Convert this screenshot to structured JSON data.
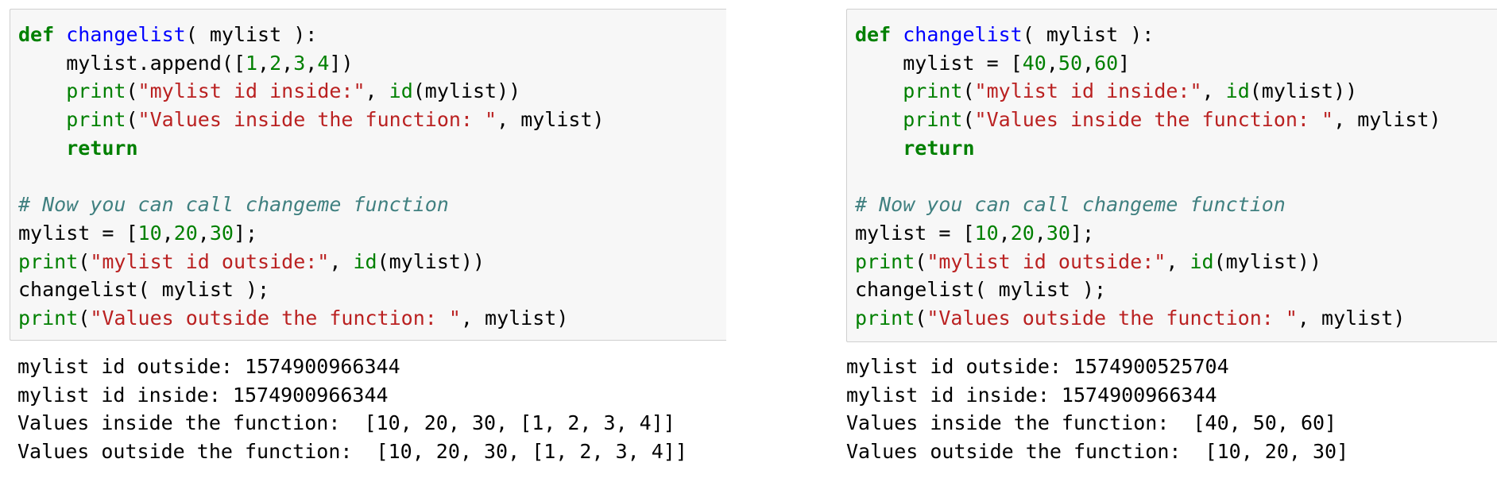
{
  "cells": [
    {
      "code": [
        [
          {
            "t": "kw",
            "v": "def"
          },
          {
            "t": "pl",
            "v": " "
          },
          {
            "t": "fn",
            "v": "changelist"
          },
          {
            "t": "pl",
            "v": "( mylist ):"
          }
        ],
        [
          {
            "t": "pl",
            "v": "    mylist.append(["
          },
          {
            "t": "num",
            "v": "1"
          },
          {
            "t": "pl",
            "v": ","
          },
          {
            "t": "num",
            "v": "2"
          },
          {
            "t": "pl",
            "v": ","
          },
          {
            "t": "num",
            "v": "3"
          },
          {
            "t": "pl",
            "v": ","
          },
          {
            "t": "num",
            "v": "4"
          },
          {
            "t": "pl",
            "v": "])"
          }
        ],
        [
          {
            "t": "pl",
            "v": "    "
          },
          {
            "t": "bi",
            "v": "print"
          },
          {
            "t": "pl",
            "v": "("
          },
          {
            "t": "str",
            "v": "\"mylist id inside:\""
          },
          {
            "t": "pl",
            "v": ", "
          },
          {
            "t": "bi",
            "v": "id"
          },
          {
            "t": "pl",
            "v": "(mylist))"
          }
        ],
        [
          {
            "t": "pl",
            "v": "    "
          },
          {
            "t": "bi",
            "v": "print"
          },
          {
            "t": "pl",
            "v": "("
          },
          {
            "t": "str",
            "v": "\"Values inside the function: \""
          },
          {
            "t": "pl",
            "v": ", mylist)"
          }
        ],
        [
          {
            "t": "pl",
            "v": "    "
          },
          {
            "t": "kw",
            "v": "return"
          }
        ],
        [
          {
            "t": "pl",
            "v": ""
          }
        ],
        [
          {
            "t": "com",
            "v": "# Now you can call changeme function"
          }
        ],
        [
          {
            "t": "pl",
            "v": "mylist = ["
          },
          {
            "t": "num",
            "v": "10"
          },
          {
            "t": "pl",
            "v": ","
          },
          {
            "t": "num",
            "v": "20"
          },
          {
            "t": "pl",
            "v": ","
          },
          {
            "t": "num",
            "v": "30"
          },
          {
            "t": "pl",
            "v": "];"
          }
        ],
        [
          {
            "t": "bi",
            "v": "print"
          },
          {
            "t": "pl",
            "v": "("
          },
          {
            "t": "str",
            "v": "\"mylist id outside:\""
          },
          {
            "t": "pl",
            "v": ", "
          },
          {
            "t": "bi",
            "v": "id"
          },
          {
            "t": "pl",
            "v": "(mylist))"
          }
        ],
        [
          {
            "t": "pl",
            "v": "changelist( mylist );"
          }
        ],
        [
          {
            "t": "bi",
            "v": "print"
          },
          {
            "t": "pl",
            "v": "("
          },
          {
            "t": "str",
            "v": "\"Values outside the function: \""
          },
          {
            "t": "pl",
            "v": ", mylist)"
          }
        ]
      ],
      "output": [
        "mylist id outside: 1574900966344",
        "mylist id inside: 1574900966344",
        "Values inside the function:  [10, 20, 30, [1, 2, 3, 4]]",
        "Values outside the function:  [10, 20, 30, [1, 2, 3, 4]]"
      ]
    },
    {
      "code": [
        [
          {
            "t": "kw",
            "v": "def"
          },
          {
            "t": "pl",
            "v": " "
          },
          {
            "t": "fn",
            "v": "changelist"
          },
          {
            "t": "pl",
            "v": "( mylist ):"
          }
        ],
        [
          {
            "t": "pl",
            "v": "    mylist = ["
          },
          {
            "t": "num",
            "v": "40"
          },
          {
            "t": "pl",
            "v": ","
          },
          {
            "t": "num",
            "v": "50"
          },
          {
            "t": "pl",
            "v": ","
          },
          {
            "t": "num",
            "v": "60"
          },
          {
            "t": "pl",
            "v": "]"
          }
        ],
        [
          {
            "t": "pl",
            "v": "    "
          },
          {
            "t": "bi",
            "v": "print"
          },
          {
            "t": "pl",
            "v": "("
          },
          {
            "t": "str",
            "v": "\"mylist id inside:\""
          },
          {
            "t": "pl",
            "v": ", "
          },
          {
            "t": "bi",
            "v": "id"
          },
          {
            "t": "pl",
            "v": "(mylist))"
          }
        ],
        [
          {
            "t": "pl",
            "v": "    "
          },
          {
            "t": "bi",
            "v": "print"
          },
          {
            "t": "pl",
            "v": "("
          },
          {
            "t": "str",
            "v": "\"Values inside the function: \""
          },
          {
            "t": "pl",
            "v": ", mylist)"
          }
        ],
        [
          {
            "t": "pl",
            "v": "    "
          },
          {
            "t": "kw",
            "v": "return"
          }
        ],
        [
          {
            "t": "pl",
            "v": ""
          }
        ],
        [
          {
            "t": "com",
            "v": "# Now you can call changeme function"
          }
        ],
        [
          {
            "t": "pl",
            "v": "mylist = ["
          },
          {
            "t": "num",
            "v": "10"
          },
          {
            "t": "pl",
            "v": ","
          },
          {
            "t": "num",
            "v": "20"
          },
          {
            "t": "pl",
            "v": ","
          },
          {
            "t": "num",
            "v": "30"
          },
          {
            "t": "pl",
            "v": "];"
          }
        ],
        [
          {
            "t": "bi",
            "v": "print"
          },
          {
            "t": "pl",
            "v": "("
          },
          {
            "t": "str",
            "v": "\"mylist id outside:\""
          },
          {
            "t": "pl",
            "v": ", "
          },
          {
            "t": "bi",
            "v": "id"
          },
          {
            "t": "pl",
            "v": "(mylist))"
          }
        ],
        [
          {
            "t": "pl",
            "v": "changelist( mylist );"
          }
        ],
        [
          {
            "t": "bi",
            "v": "print"
          },
          {
            "t": "pl",
            "v": "("
          },
          {
            "t": "str",
            "v": "\"Values outside the function: \""
          },
          {
            "t": "pl",
            "v": ", mylist)"
          }
        ]
      ],
      "output": [
        "mylist id outside: 1574900525704",
        "mylist id inside: 1574900966344",
        "Values inside the function:  [40, 50, 60]",
        "Values outside the function:  [10, 20, 30]"
      ]
    }
  ],
  "colors": {
    "keyword": "#008000",
    "function_name": "#0000ff",
    "builtin": "#008000",
    "string": "#ba2121",
    "number": "#008000",
    "comment": "#408080",
    "code_background": "#f7f7f7",
    "code_border": "#cfcfcf"
  }
}
